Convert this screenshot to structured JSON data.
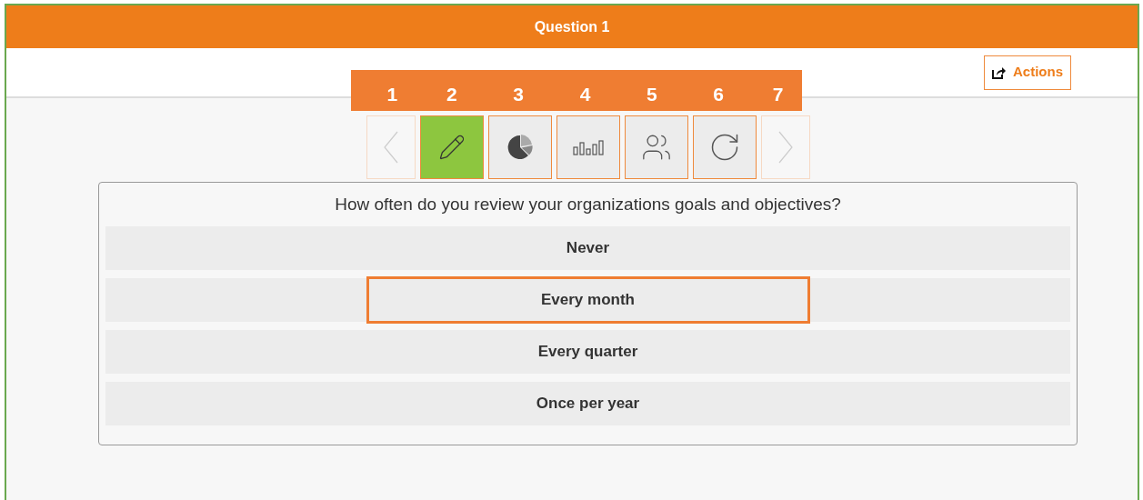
{
  "header": {
    "title": "Question 1"
  },
  "actions_button": {
    "label": "Actions"
  },
  "step_numbers": [
    "1",
    "2",
    "3",
    "4",
    "5",
    "6",
    "7"
  ],
  "toolbar": [
    {
      "kind": "prev",
      "selected": false,
      "disabled": true
    },
    {
      "kind": "edit",
      "selected": true,
      "disabled": false
    },
    {
      "kind": "pie",
      "selected": false,
      "disabled": false
    },
    {
      "kind": "bars",
      "selected": false,
      "disabled": false
    },
    {
      "kind": "people",
      "selected": false,
      "disabled": false
    },
    {
      "kind": "refresh",
      "selected": false,
      "disabled": false
    },
    {
      "kind": "next",
      "selected": false,
      "disabled": true
    }
  ],
  "question": {
    "text": "How often do you review your organizations goals and objectives?",
    "options": [
      {
        "label": "Never",
        "selected": false
      },
      {
        "label": "Every month",
        "selected": true
      },
      {
        "label": "Every quarter",
        "selected": false
      },
      {
        "label": "Once per year",
        "selected": false
      }
    ]
  }
}
